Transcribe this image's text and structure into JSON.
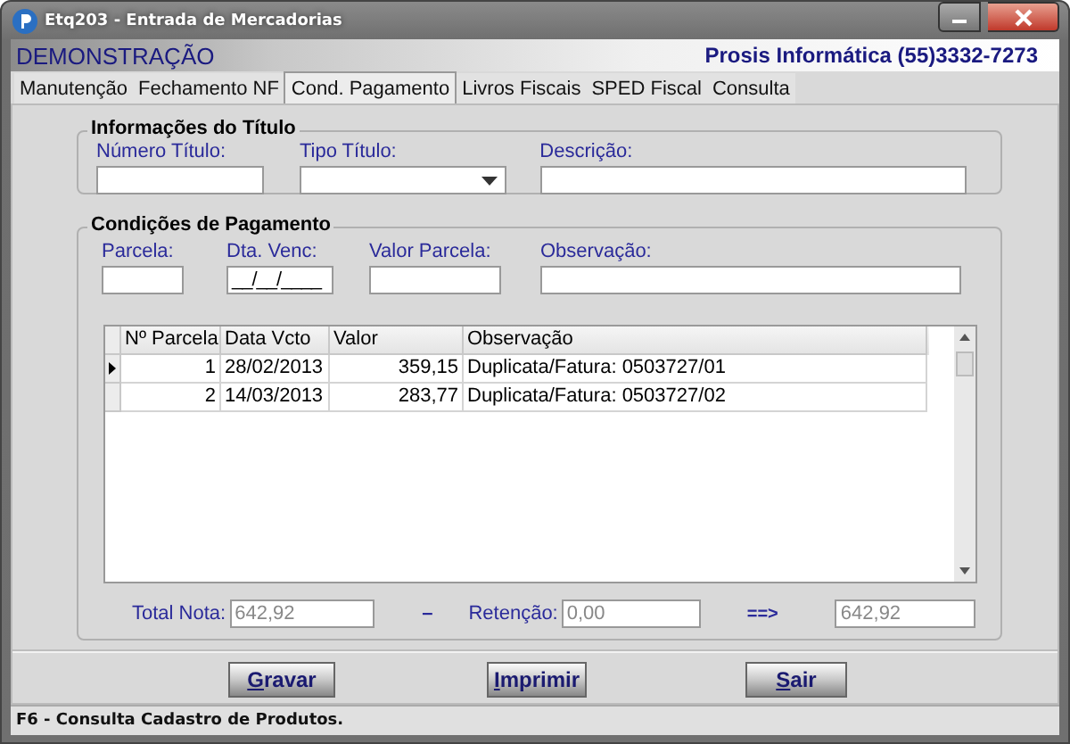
{
  "window": {
    "title": "Etq203 - Entrada de Mercadorias"
  },
  "header": {
    "company": "DEMONSTRAÇÃO",
    "vendor": "Prosis Informática (55)3332-7273"
  },
  "tabs": [
    {
      "label": "Manutenção",
      "selected": false
    },
    {
      "label": "Fechamento NF",
      "selected": false
    },
    {
      "label": "Cond. Pagamento",
      "selected": true
    },
    {
      "label": "Livros Fiscais",
      "selected": false
    },
    {
      "label": "SPED Fiscal",
      "selected": false
    },
    {
      "label": "Consulta",
      "selected": false
    }
  ],
  "titulo": {
    "title": "Informações do Título",
    "fields": [
      {
        "label": "Número Título:",
        "kind": "text"
      },
      {
        "label": "Tipo Título:",
        "kind": "dropdown"
      },
      {
        "label": "Descrição:",
        "kind": "text"
      }
    ]
  },
  "pagamento": {
    "title": "Condições de Pagamento",
    "fields": [
      {
        "label": "Parcela:",
        "kind": "text"
      },
      {
        "label": "Dta. Venc:",
        "kind": "text",
        "value": "__/__/____"
      },
      {
        "label": "Valor Parcela:",
        "kind": "text"
      },
      {
        "label": "Observação:",
        "kind": "text"
      }
    ],
    "table": {
      "columns": [
        "Nº Parcela",
        "Data Vcto",
        "Valor",
        "Observação"
      ],
      "rows": [
        {
          "selected": true,
          "cells": [
            "1",
            "28/02/2013",
            "359,15",
            "Duplicata/Fatura: 0503727/01"
          ]
        },
        {
          "selected": false,
          "cells": [
            "2",
            "14/03/2013",
            "283,77",
            "Duplicata/Fatura: 0503727/02"
          ]
        }
      ]
    },
    "totals": {
      "total_label": "Total Nota:",
      "total_value": "642,92",
      "minus": "–",
      "retencao_label": "Retenção:",
      "retencao_value": "0,00",
      "arrow": "==>",
      "result_value": "642,92"
    }
  },
  "buttons": [
    "Gravar",
    "Imprimir",
    "Sair"
  ],
  "status_bar": "F6 - Consulta Cadastro de Produtos."
}
